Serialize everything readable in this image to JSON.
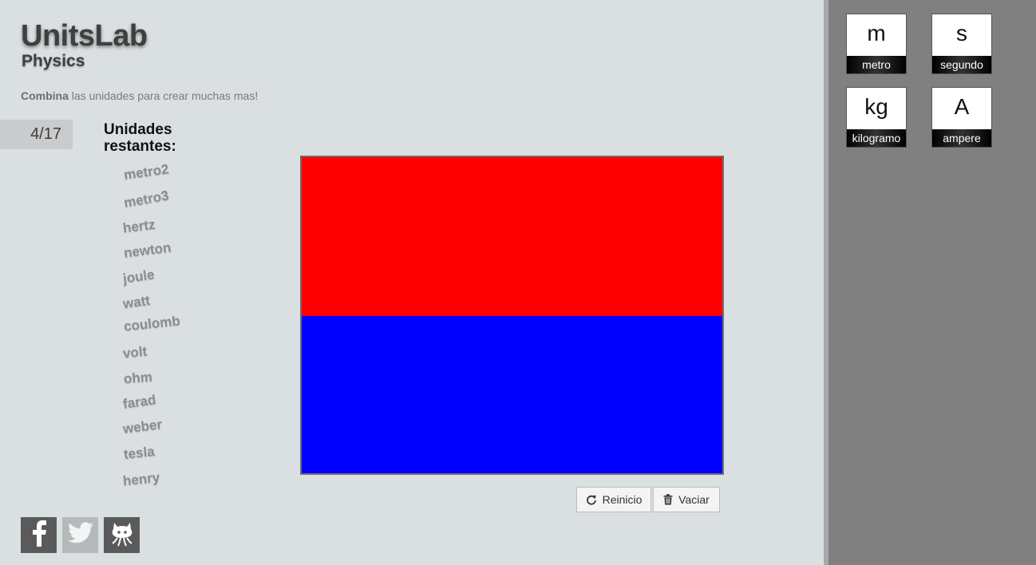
{
  "brand": {
    "title": "UnitsLab",
    "subtitle": "Physics"
  },
  "tagline": {
    "bold": "Combina",
    "rest": " las unidades para crear muchas mas!"
  },
  "progress": {
    "label": "4/17"
  },
  "remaining": {
    "title": "Unidades restantes:",
    "units": [
      "metro2",
      "metro3",
      "hertz",
      "newton",
      "joule",
      "watt",
      "coulomb",
      "volt",
      "ohm",
      "farad",
      "weber",
      "tesla",
      "henry"
    ]
  },
  "canvas": {
    "colors": [
      "#ff0000",
      "#0000ff"
    ]
  },
  "buttons": {
    "reset": "Reinicio",
    "clear": "Vaciar"
  },
  "social": [
    "facebook-icon",
    "twitter-icon",
    "github-icon"
  ],
  "tiles": [
    {
      "symbol": "m",
      "name": "metro"
    },
    {
      "symbol": "s",
      "name": "segundo"
    },
    {
      "symbol": "kg",
      "name": "kilogramo"
    },
    {
      "symbol": "A",
      "name": "ampere"
    }
  ]
}
